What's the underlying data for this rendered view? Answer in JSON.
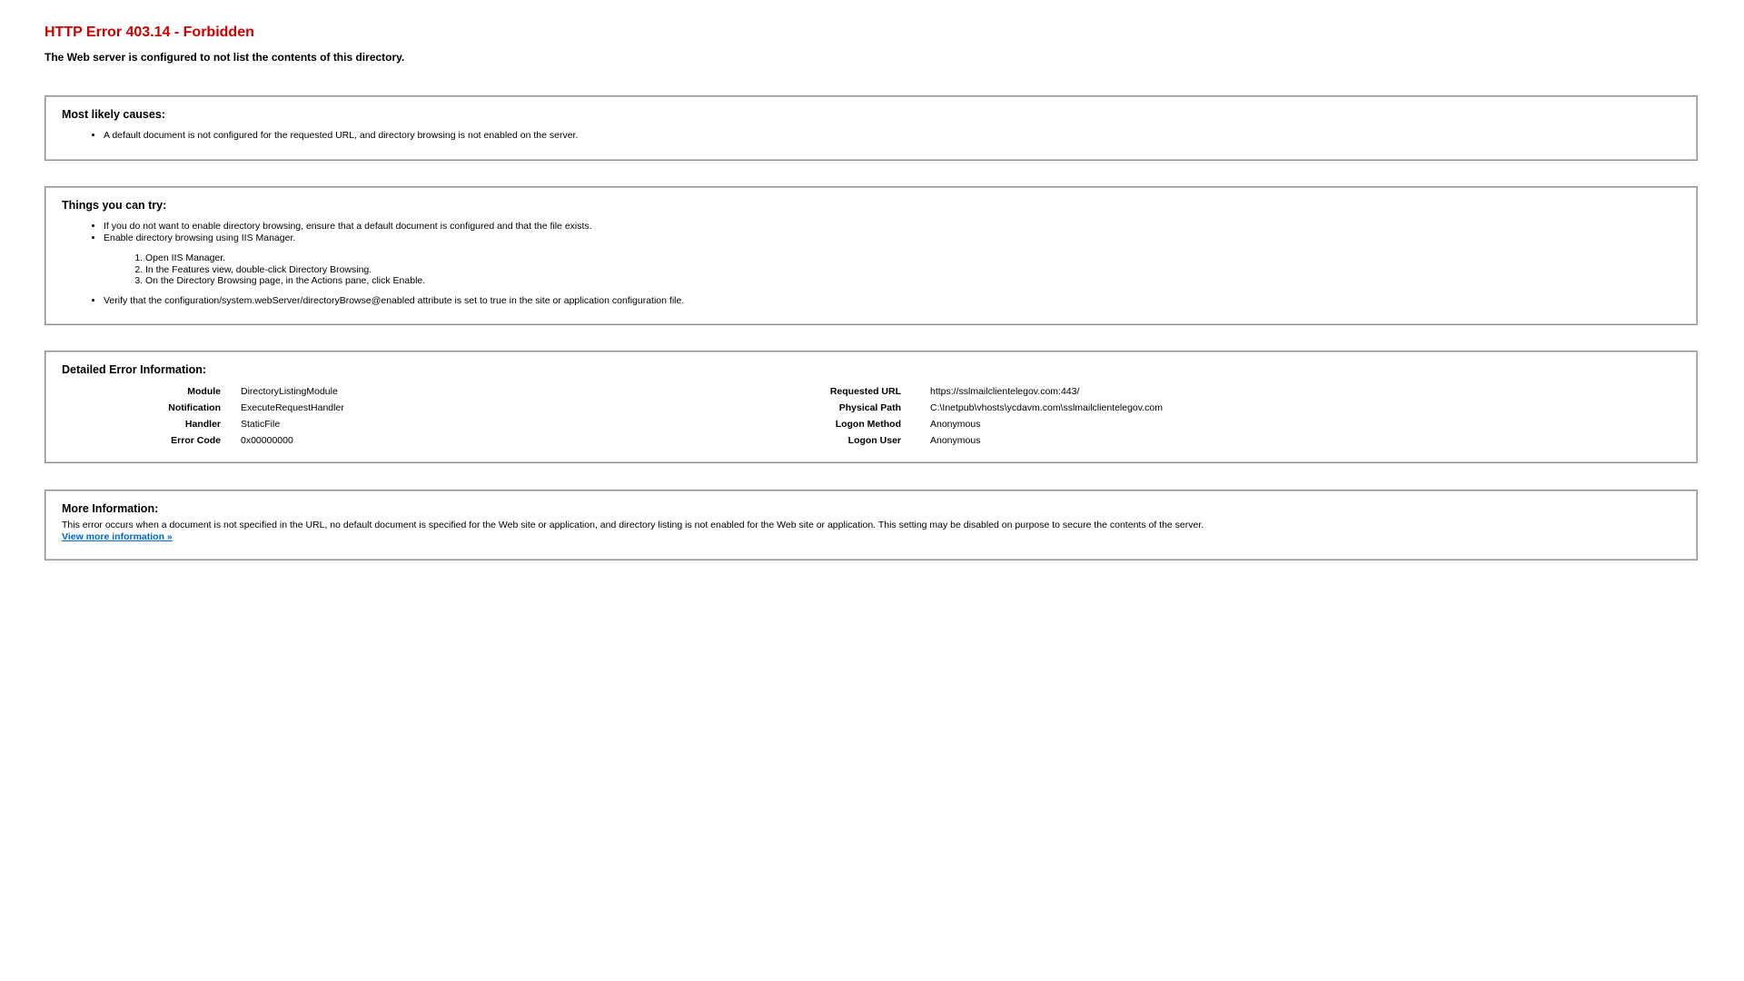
{
  "header": {
    "title": "HTTP Error 403.14 - Forbidden",
    "subtitle": "The Web server is configured to not list the contents of this directory."
  },
  "causes": {
    "heading": "Most likely causes:",
    "items": [
      "A default document is not configured for the requested URL, and directory browsing is not enabled on the server."
    ]
  },
  "try": {
    "heading": "Things you can try:",
    "items": [
      "If you do not want to enable directory browsing, ensure that a default document is configured and that the file exists.",
      "Enable directory browsing using IIS Manager.",
      "Verify that the configuration/system.webServer/directoryBrowse@enabled attribute is set to true in the site or application configuration file."
    ],
    "steps": [
      "Open IIS Manager.",
      "In the Features view, double-click Directory Browsing.",
      "On the Directory Browsing page, in the Actions pane, click Enable."
    ]
  },
  "detail": {
    "heading": "Detailed Error Information:",
    "left": [
      {
        "label": "Module",
        "value": "DirectoryListingModule"
      },
      {
        "label": "Notification",
        "value": "ExecuteRequestHandler"
      },
      {
        "label": "Handler",
        "value": "StaticFile"
      },
      {
        "label": "Error Code",
        "value": "0x00000000"
      }
    ],
    "right": [
      {
        "label": "Requested URL",
        "value": "https://sslmailclientelegov.com:443/"
      },
      {
        "label": "Physical Path",
        "value": "C:\\Inetpub\\vhosts\\ycdavm.com\\sslmailclientelegov.com"
      },
      {
        "label": "Logon Method",
        "value": "Anonymous"
      },
      {
        "label": "Logon User",
        "value": "Anonymous"
      }
    ]
  },
  "more": {
    "heading": "More Information:",
    "text": "This error occurs when a document is not specified in the URL, no default document is specified for the Web site or application, and directory listing is not enabled for the Web site or application. This setting may be disabled on purpose to secure the contents of the server.",
    "link_label": "View more information »"
  },
  "colors": {
    "title": "#cc0000",
    "link": "#0066cc",
    "border": "#8e8e8e"
  }
}
